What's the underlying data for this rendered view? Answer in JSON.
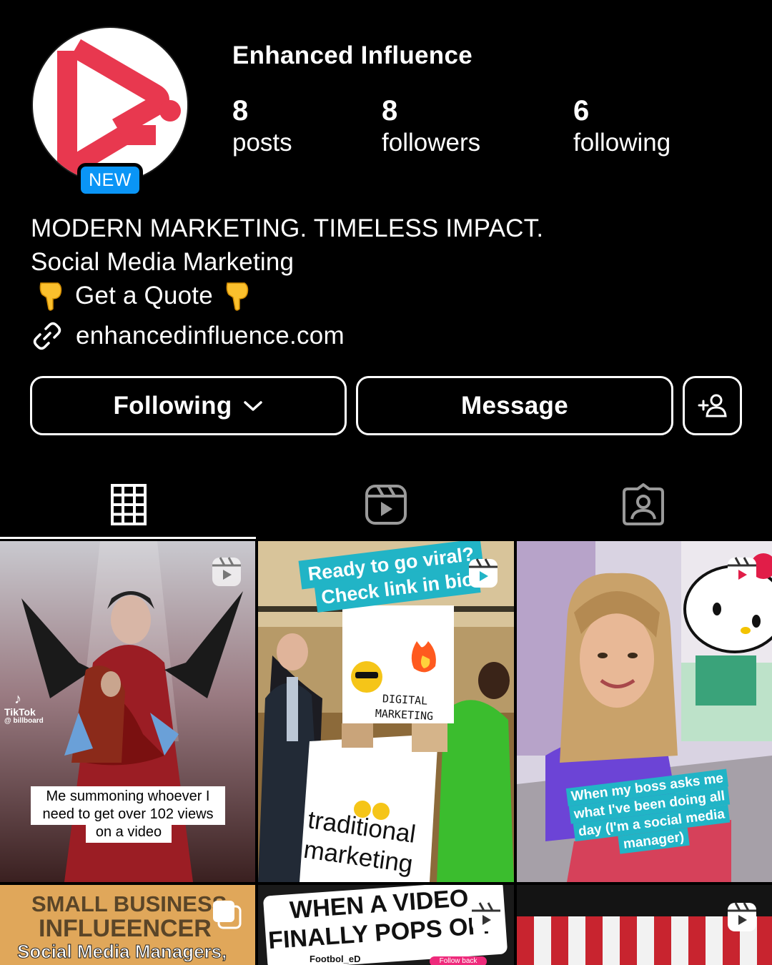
{
  "profile": {
    "username": "Enhanced Influence",
    "avatar_badge": "NEW",
    "stats": {
      "posts_count": "8",
      "posts_label": "posts",
      "followers_count": "8",
      "followers_label": "followers",
      "following_count": "6",
      "following_label": "following"
    },
    "bio": {
      "line1": "MODERN MARKETING. TIMELESS IMPACT.",
      "line2": "Social Media Marketing",
      "line3": "Get a Quote",
      "line3_icon": "pointing-down-hand-emoji"
    },
    "website": "enhancedinfluence.com",
    "brand_color": "#e8384f",
    "badge_color": "#0a95f6"
  },
  "actions": {
    "following_label": "Following",
    "message_label": "Message",
    "add_user_icon": "add-person-icon"
  },
  "tabs": [
    {
      "name": "posts-grid",
      "icon": "grid-icon",
      "active": true
    },
    {
      "name": "reels",
      "icon": "reels-icon",
      "active": false
    },
    {
      "name": "tagged",
      "icon": "tagged-person-icon",
      "active": false
    }
  ],
  "posts": [
    {
      "watermark_brand": "TikTok",
      "watermark_handle": "@ billboard",
      "caption_l1": "Me summoning whoever I",
      "caption_l2": "need to get over 102 views",
      "caption_l3": "on a video"
    },
    {
      "header_l1": "Ready to go viral?",
      "header_l2": "Check link in bio",
      "label_top_l1": "DIGITAL",
      "label_top_l2": "MARKETING",
      "label_bottom_l1": "traditional",
      "label_bottom_l2": "marketing"
    },
    {
      "caption_l1": "When my boss asks me",
      "caption_l2": "what I've been doing all",
      "caption_l3": "day (I'm a social media",
      "caption_l4": "manager)"
    },
    {
      "title_l1": "SMALL BUSINESS",
      "title_l2": "INFLUEENCER",
      "title_l3": "Social Media Managers,"
    },
    {
      "title_l1": "WHEN A VIDEO",
      "title_l2": "FINALLY POPS OFF",
      "handle": "Footbol_eD",
      "follow_back": "Follow back"
    },
    {}
  ]
}
